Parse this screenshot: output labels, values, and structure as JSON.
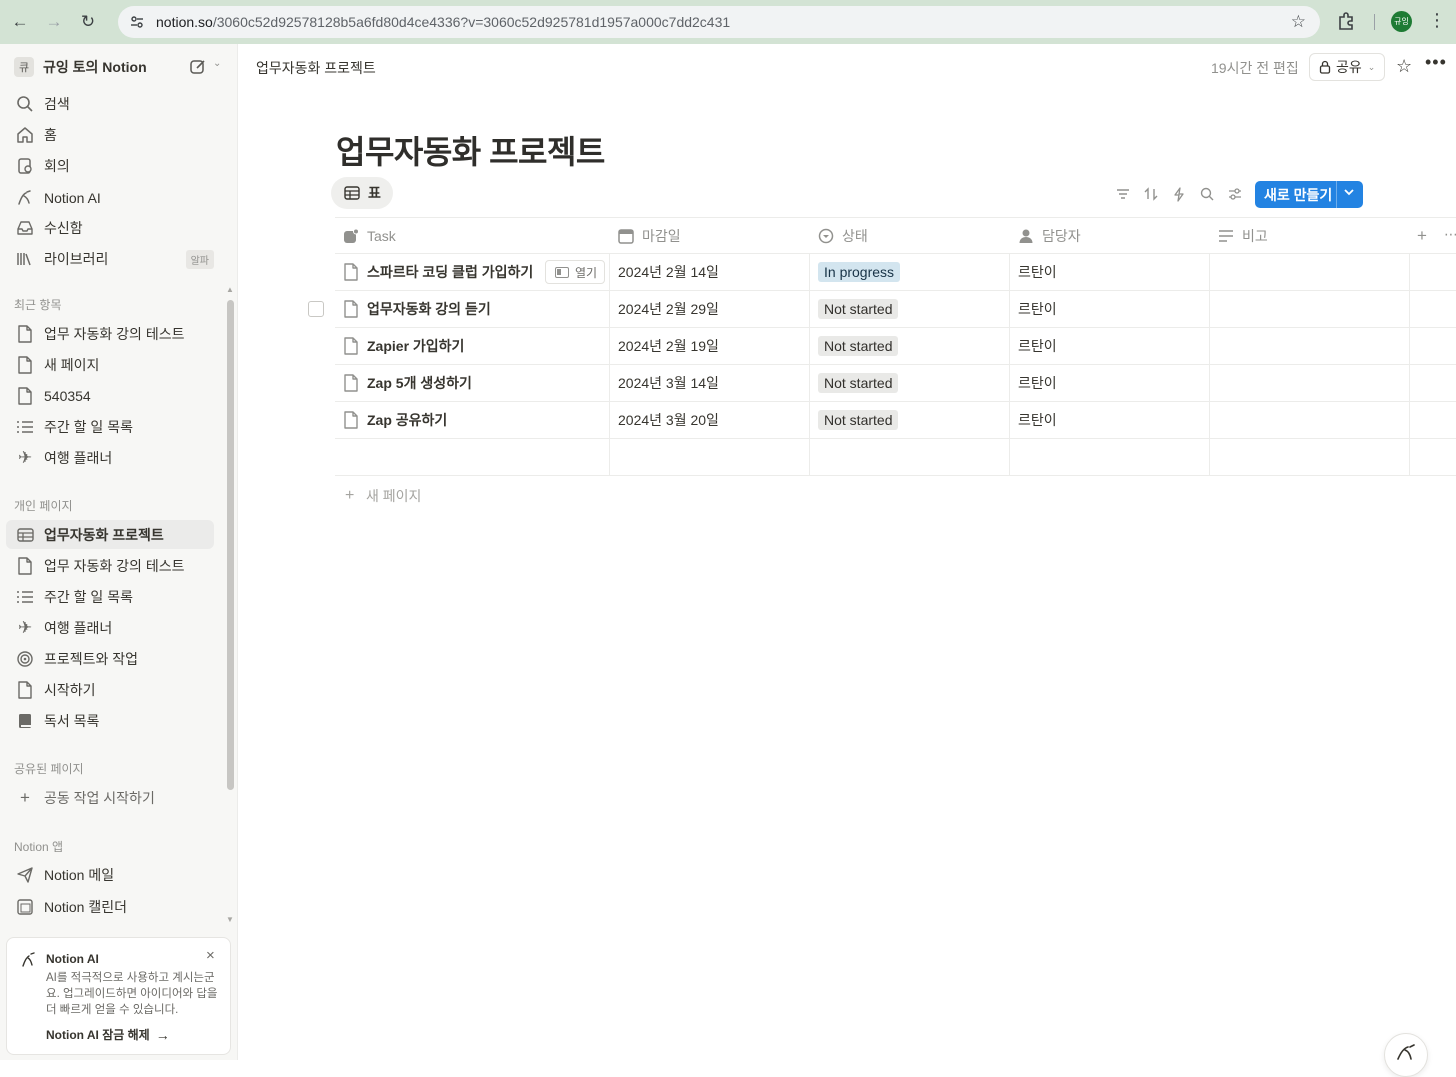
{
  "browser": {
    "url_main": "notion.so",
    "url_rest": "/3060c52d92578128b5a6fd80d4ce4336?v=3060c52d925781d1957a000c7dd2c431",
    "profile_label": "규잉"
  },
  "sidebar": {
    "workspace_badge": "큐",
    "workspace_name": "규잉 토의 Notion",
    "nav": [
      {
        "label": "검색",
        "icon": "search-icon"
      },
      {
        "label": "홈",
        "icon": "home-icon"
      },
      {
        "label": "회의",
        "icon": "meeting-icon"
      },
      {
        "label": "Notion AI",
        "icon": "notion-ai-icon"
      },
      {
        "label": "수신함",
        "icon": "inbox-icon"
      },
      {
        "label": "라이브러리",
        "icon": "library-icon",
        "badge": "알파"
      }
    ],
    "recent_heading": "최근 항목",
    "recent": [
      {
        "label": "업무 자동화 강의 테스트",
        "icon": "page-icon"
      },
      {
        "label": "새 페이지",
        "icon": "page-icon"
      },
      {
        "label": "540354",
        "icon": "page-icon"
      },
      {
        "label": "주간 할 일 목록",
        "icon": "checklist-icon"
      },
      {
        "label": "여행 플래너",
        "icon": "airplane-icon"
      }
    ],
    "personal_heading": "개인 페이지",
    "personal": [
      {
        "label": "업무자동화 프로젝트",
        "icon": "table-icon",
        "active": true
      },
      {
        "label": "업무 자동화 강의 테스트",
        "icon": "page-icon"
      },
      {
        "label": "주간 할 일 목록",
        "icon": "checklist-icon"
      },
      {
        "label": "여행 플래너",
        "icon": "airplane-icon"
      },
      {
        "label": "프로젝트와 작업",
        "icon": "target-icon"
      },
      {
        "label": "시작하기",
        "icon": "page-icon"
      },
      {
        "label": "독서 목록",
        "icon": "book-icon"
      }
    ],
    "shared_heading": "공유된 페이지",
    "shared_action": "공동 작업 시작하기",
    "apps_heading": "Notion 앱",
    "apps": [
      {
        "label": "Notion 메일",
        "icon": "mail-send-icon"
      },
      {
        "label": "Notion 캘린더",
        "icon": "calendar-icon"
      }
    ],
    "ai_card": {
      "title": "Notion AI",
      "desc": "AI를 적극적으로 사용하고 계시는군요. 업그레이드하면 아이디어와 답을 더 빠르게 얻을 수 있습니다.",
      "cta": "Notion AI 잠금 해제"
    }
  },
  "topbar": {
    "breadcrumb": "업무자동화 프로젝트",
    "edited": "19시간 전 편집",
    "share_label": "공유"
  },
  "page": {
    "title": "업무자동화 프로젝트",
    "view_tab": "표",
    "new_button": "새로 만들기",
    "add_page": "새 페이지"
  },
  "table": {
    "columns": [
      {
        "label": "Task",
        "icon": "title-icon"
      },
      {
        "label": "마감일",
        "icon": "calendar-icon"
      },
      {
        "label": "상태",
        "icon": "status-icon"
      },
      {
        "label": "담당자",
        "icon": "person-icon"
      },
      {
        "label": "비고",
        "icon": "text-icon"
      }
    ],
    "open_label": "열기",
    "rows": [
      {
        "task": "스파르타 코딩 클럽 가입하기",
        "due": "2024년 2월 14일",
        "status": "In progress",
        "status_kind": "prog",
        "owner": "르탄이",
        "note": ""
      },
      {
        "task": "업무자동화 강의 듣기",
        "due": "2024년 2월 29일",
        "status": "Not started",
        "status_kind": "not",
        "owner": "르탄이",
        "note": ""
      },
      {
        "task": "Zapier 가입하기",
        "due": "2024년 2월 19일",
        "status": "Not started",
        "status_kind": "not",
        "owner": "르탄이",
        "note": ""
      },
      {
        "task": "Zap 5개 생성하기",
        "due": "2024년 3월 14일",
        "status": "Not started",
        "status_kind": "not",
        "owner": "르탄이",
        "note": ""
      },
      {
        "task": "Zap 공유하기",
        "due": "2024년 3월 20일",
        "status": "Not started",
        "status_kind": "not",
        "owner": "르탄이",
        "note": ""
      }
    ]
  },
  "colors": {
    "accent": "#2383e2",
    "in_progress_bg": "#d3e5ef",
    "not_started_bg": "#e9e9e7",
    "sidebar_bg": "#f7f7f5"
  }
}
